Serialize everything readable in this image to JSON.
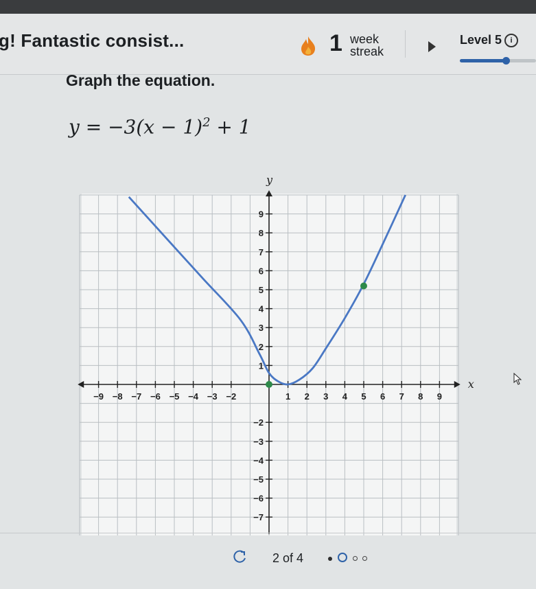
{
  "header": {
    "title": "g! Fantastic consist...",
    "streak_number": "1",
    "streak_word_line1": "week",
    "streak_word_line2": "streak",
    "level_label": "Level 5",
    "level_progress": 0.6
  },
  "question": {
    "prompt": "Graph the equation.",
    "equation_prefix": "y = −3(x − 1)",
    "equation_exponent": "2",
    "equation_suffix": " + 1"
  },
  "graph": {
    "y_axis_label": "y",
    "x_axis_label": "x",
    "x_range": [
      -10,
      10
    ],
    "y_range": [
      -8,
      10
    ],
    "x_tick_labels": [
      "−9",
      "−8",
      "−7",
      "−6",
      "−5",
      "−4",
      "−3",
      "−2",
      "1",
      "2",
      "3",
      "4",
      "5",
      "6",
      "7",
      "8",
      "9"
    ],
    "y_tick_labels_pos": [
      "1",
      "2",
      "3",
      "4",
      "5",
      "6",
      "7",
      "8",
      "9"
    ],
    "y_tick_labels_neg": [
      "−2",
      "−3",
      "−4",
      "−5",
      "−6",
      "−7"
    ],
    "curve_points": [
      [
        -7.4,
        9.9
      ],
      [
        -5.5,
        7.8
      ],
      [
        -3.5,
        5.6
      ],
      [
        -1.5,
        3.4
      ],
      [
        -0.5,
        1.6
      ],
      [
        0,
        0.6
      ],
      [
        0.5,
        0.15
      ],
      [
        1,
        0
      ],
      [
        1.6,
        0.25
      ],
      [
        2.3,
        0.85
      ],
      [
        3,
        1.9
      ],
      [
        4,
        3.5
      ],
      [
        5,
        5.3
      ],
      [
        6,
        7.4
      ],
      [
        7.2,
        10
      ]
    ],
    "curve_color": "#4a78c4",
    "point_color": "#2e8a4a",
    "points": [
      [
        0,
        0
      ],
      [
        5,
        5.2
      ]
    ]
  },
  "footer": {
    "counter": "2 of 4"
  }
}
